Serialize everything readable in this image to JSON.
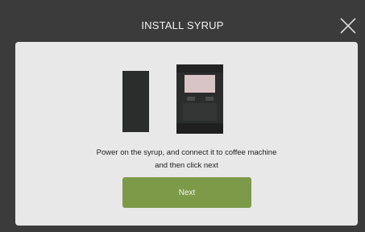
{
  "header": {
    "title": "INSTALL SYRUP",
    "close_icon": "close-icon"
  },
  "illustration": {
    "syrup_unit_icon": "syrup-unit-illustration",
    "coffee_machine_icon": "coffee-machine-illustration"
  },
  "message": {
    "line1": "Power on the syrup, and connect it to coffee machine",
    "line2": "and then click next"
  },
  "actions": {
    "next_label": "Next"
  },
  "colors": {
    "background": "#3b3b3b",
    "panel": "#e8e8e8",
    "accent_button": "#7d9a48"
  }
}
